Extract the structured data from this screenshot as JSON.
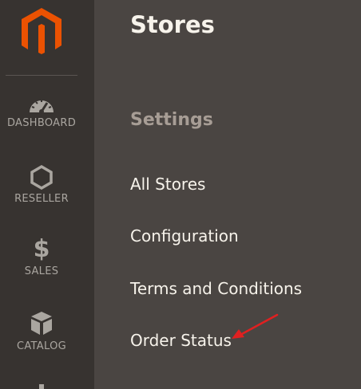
{
  "sidebar": {
    "items": [
      {
        "label": "DASHBOARD",
        "icon": "dashboard-icon"
      },
      {
        "label": "RESELLER",
        "icon": "hexagon-icon"
      },
      {
        "label": "SALES",
        "icon": "dollar-icon"
      },
      {
        "label": "CATALOG",
        "icon": "box-icon"
      }
    ],
    "sales_symbol": "$"
  },
  "panel": {
    "title": "Stores",
    "section": "Settings",
    "links": [
      "All Stores",
      "Configuration",
      "Terms and Conditions",
      "Order Status"
    ]
  },
  "colors": {
    "brand_orange": "#eb5202",
    "annotation_arrow": "#e02020",
    "sidebar_bg": "#373330",
    "panel_bg": "#4a4542"
  }
}
